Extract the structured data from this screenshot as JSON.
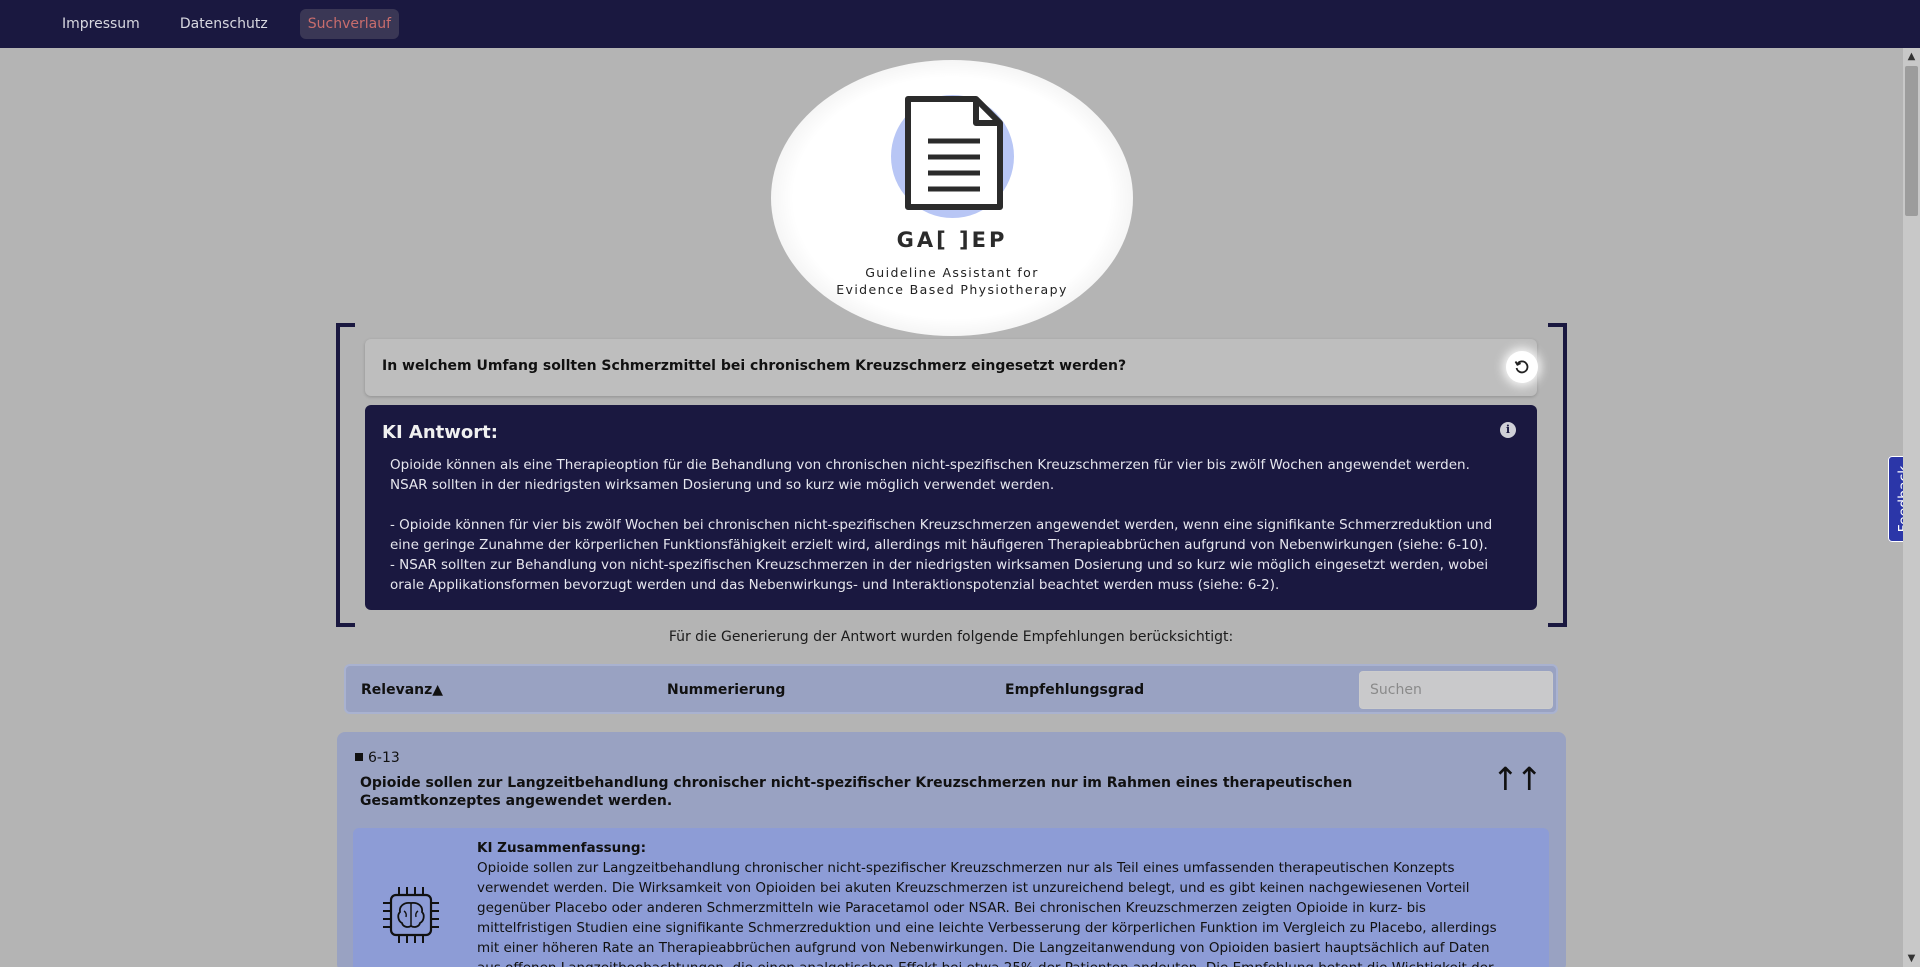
{
  "nav": {
    "items": [
      {
        "label": "Impressum"
      },
      {
        "label": "Datenschutz"
      },
      {
        "label": "Suchverlauf",
        "active": true
      }
    ]
  },
  "logo": {
    "title": "GA[ ]EP",
    "subtitle_line1": "Guideline Assistant for",
    "subtitle_line2": "Evidence Based Physiotherapy"
  },
  "query": {
    "text": "In welchem Umfang sollten Schmerzmittel bei chronischem Kreuzschmerz eingesetzt werden?"
  },
  "answer": {
    "title": "KI Antwort:",
    "paragraph1": "Opioide können als eine Therapieoption für die Behandlung von chronischen nicht-spezifischen Kreuzschmerzen für vier bis zwölf Wochen angewendet werden. NSAR sollten in der niedrigsten wirksamen Dosierung und so kurz wie möglich verwendet werden.",
    "bullet1": "- Opioide können für vier bis zwölf Wochen bei chronischen nicht-spezifischen Kreuzschmerzen angewendet werden, wenn eine signifikante Schmerzreduktion und eine geringe Zunahme der körperlichen Funktionsfähigkeit erzielt wird, allerdings mit häufigeren Therapieabbrüchen aufgrund von Nebenwirkungen (siehe: 6-10).",
    "bullet2": "- NSAR sollten zur Behandlung von nicht-spezifischen Kreuzschmerzen in der niedrigsten wirksamen Dosierung und so kurz wie möglich eingesetzt werden, wobei orale Applikationsformen bevorzugt werden und das Nebenwirkungs- und Interaktionspotenzial beachtet werden muss (siehe: 6-2)."
  },
  "consider_text": "Für die Generierung der Antwort wurden folgende Empfehlungen berücksichtigt:",
  "table": {
    "col_relevance": "Relevanz▲",
    "col_numbering": "Nummerierung",
    "col_grade": "Empfehlungsgrad",
    "search_placeholder": "Suchen"
  },
  "recommendation": {
    "number": "6-13",
    "text": "Opioide sollen zur Langzeitbehandlung chronischer nicht-spezifischer Kreuzschmerzen nur im Rahmen eines therapeutischen Gesamtkonzeptes angewendet werden.",
    "grade": "↑↑",
    "summary_label": "KI Zusammenfassung:",
    "summary_text": "Opioide sollen zur Langzeitbehandlung chronischer nicht-spezifischer Kreuzschmerzen nur als Teil eines umfassenden therapeutischen Konzepts verwendet werden. Die Wirksamkeit von Opioiden bei akuten Kreuzschmerzen ist unzureichend belegt, und es gibt keinen nachgewiesenen Vorteil gegenüber Placebo oder anderen Schmerzmitteln wie Paracetamol oder NSAR. Bei chronischen Kreuzschmerzen zeigten Opioide in kurz- bis mittelfristigen Studien eine signifikante Schmerzreduktion und eine leichte Verbesserung der körperlichen Funktion im Vergleich zu Placebo, allerdings mit einer höheren Rate an Therapieabbrüchen aufgrund von Nebenwirkungen. Die Langzeitanwendung von Opioiden basiert hauptsächlich auf Daten aus offenen Langzeitbeobachtungen, die einen analgetischen Effekt bei etwa 25% der Patienten andeuten. Die Empfehlung betont die Wichtigkeit der Einbindung von"
  },
  "feedback": {
    "label": "Feedback"
  },
  "colors": {
    "navy": "#1a1840",
    "active_link": "#c96d6d",
    "card": "#99a2c2",
    "summary": "#8d9cd6",
    "feedback": "#2b36a8"
  }
}
